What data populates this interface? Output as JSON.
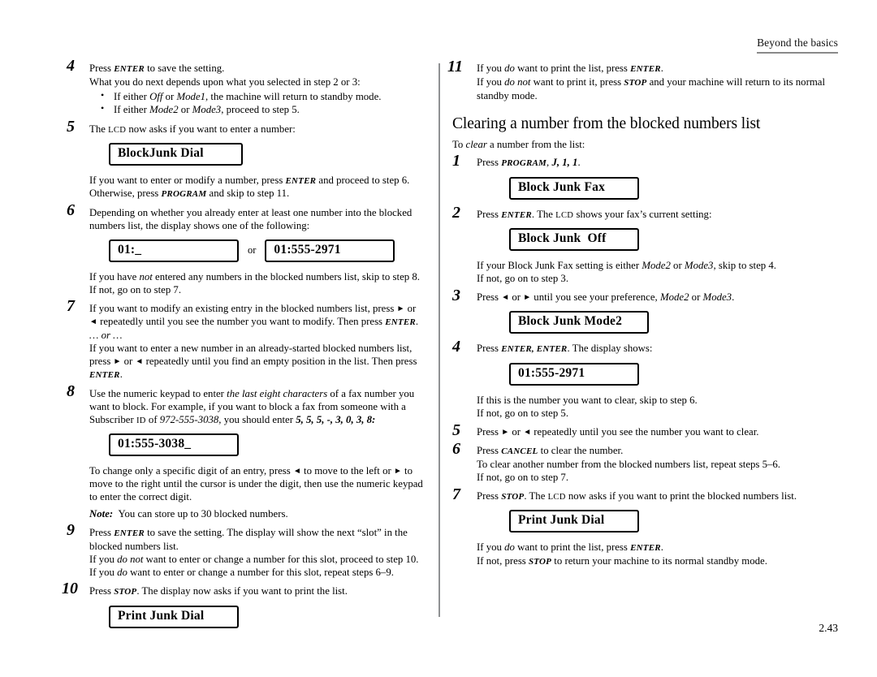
{
  "header": {
    "running_head": "Beyond the basics"
  },
  "footer": {
    "page_number": "2.43"
  },
  "left_column": {
    "step4": {
      "number": "4",
      "line1_a": "Press ",
      "line1_key": "ENTER",
      "line1_b": " to save the setting.",
      "line2": "What you do next depends upon what you selected in step 2 or 3:",
      "bullet1_a": "If either ",
      "bullet1_it1": "Off",
      "bullet1_b": " or ",
      "bullet1_it2": "Mode1",
      "bullet1_c": ", the machine will return to standby mode.",
      "bullet2_a": "If either ",
      "bullet2_it1": "Mode2",
      "bullet2_b": " or ",
      "bullet2_it2": "Mode3",
      "bullet2_c": ", proceed to step 5."
    },
    "step5": {
      "number": "5",
      "text_a": "The ",
      "text_sc": "LCD",
      "text_b": " now asks if you want to enter a number:",
      "lcd": "BlockJunk Dial",
      "after_a": "If you want to enter or modify a number, press ",
      "after_key1": "ENTER",
      "after_b": " and proceed to step 6.",
      "after_c": "Otherwise, press ",
      "after_key2": "PROGRAM",
      "after_d": " and skip to step 11."
    },
    "step6": {
      "number": "6",
      "text": "Depending on whether you already enter at least one number into the blocked numbers list, the display shows one of the following:",
      "lcd_left": "01:_",
      "or_label": "or",
      "lcd_right": "01:555-2971",
      "after_a": "If you have ",
      "after_it": "not",
      "after_b": " entered any numbers in the blocked numbers list, skip to step 8.",
      "after_c": "If not, go on to step 7."
    },
    "step7": {
      "number": "7",
      "line1_a": "If you want to modify an existing entry in the blocked numbers list, press ",
      "arrow_right": "►",
      "line1_b": " or ",
      "arrow_left": "◄",
      "line1_c": " repeatedly until you see the number you want to modify. Then press ",
      "line1_key": "ENTER",
      "line1_d": ".",
      "or_sep": "… or …",
      "line2_a": "If you want to enter a new number in an already-started blocked numbers list, press ",
      "line2_b": " or ",
      "line2_c": " repeatedly until you find an empty position in the list. Then press ",
      "line2_key": "ENTER",
      "line2_d": "."
    },
    "step8": {
      "number": "8",
      "text_a": "Use the numeric keypad to enter ",
      "text_it1": "the last eight characters",
      "text_b": " of a fax number you want to block. For example, if you want to block a fax from someone with a Subscriber ",
      "text_sc": "ID",
      "text_c": " of ",
      "text_it2": "972-555-3038",
      "text_d": ", you should enter ",
      "text_bi": "5, 5, 5, -, 3, 0, 3, 8:",
      "lcd": "01:555-3038_",
      "after_a": "To change only a specific digit of an entry, press ",
      "arrow_left": "◄",
      "after_b": " to move to the left or ",
      "arrow_right": "►",
      "after_c": " to move to the right until the cursor is under the digit, then use the numeric keypad to enter the correct digit.",
      "note_label": "Note:",
      "note_text": "You can store up to 30 blocked numbers."
    },
    "step9": {
      "number": "9",
      "line1_a": "Press ",
      "line1_key": "ENTER",
      "line1_b": " to save the setting. The display will show the next “slot” in the blocked numbers list.",
      "line2_a": "If you ",
      "line2_it": "do not",
      "line2_b": " want to enter or change a number for this slot, proceed to step 10.",
      "line3_a": "If you ",
      "line3_it": "do",
      "line3_b": " want to enter or change a number for this slot, repeat steps 6–9."
    },
    "step10": {
      "number": "10",
      "text_a": "Press ",
      "text_key": "STOP",
      "text_b": ". The display now asks if you want to print the list.",
      "lcd": "Print Junk Dial"
    }
  },
  "right_column": {
    "step11": {
      "number": "11",
      "line1_a": "If you ",
      "line1_it": "do",
      "line1_b": " want to print the list, press ",
      "line1_key": "ENTER",
      "line1_c": ".",
      "line2_a": "If you ",
      "line2_it": "do not",
      "line2_b": " want to print it, press ",
      "line2_key": "STOP",
      "line2_c": " and your machine will return to its normal standby mode."
    },
    "section": {
      "heading": "Clearing a number from the blocked numbers list",
      "intro_a": "To ",
      "intro_it": "clear",
      "intro_b": " a number from the list:"
    },
    "step1": {
      "number": "1",
      "text_a": "Press ",
      "text_key": "PROGRAM",
      "text_b": ", ",
      "text_bi": "J, 1, 1",
      "text_c": ".",
      "lcd": "Block Junk Fax"
    },
    "step2": {
      "number": "2",
      "text_a": "Press ",
      "text_key": "ENTER",
      "text_b": ". The ",
      "text_sc": "LCD",
      "text_c": " shows your fax’s current setting:",
      "lcd": "Block Junk  Off",
      "after_a": "If your Block Junk Fax setting is either ",
      "after_it1": "Mode2",
      "after_b": " or ",
      "after_it2": "Mode3,",
      "after_c": " skip to step 4.",
      "after_d": "If not, go on to step 3."
    },
    "step3": {
      "number": "3",
      "text_a": "Press ",
      "arrow_left": "◄",
      "text_b": " or ",
      "arrow_right": "►",
      "text_c": " until you see your preference, ",
      "text_it1": "Mode2",
      "text_d": " or ",
      "text_it2": "Mode3",
      "text_e": ".",
      "lcd": "Block Junk Mode2"
    },
    "step4": {
      "number": "4",
      "text_a": "Press ",
      "text_key": "ENTER, ENTER",
      "text_b": ". The display shows:",
      "lcd": "01:555-2971",
      "after_a": "If this is the number you want to clear, skip to step 6.",
      "after_b": "If not, go on to step 5."
    },
    "step5": {
      "number": "5",
      "text_a": "Press ",
      "arrow_right": "►",
      "text_b": " or ",
      "arrow_left": "◄",
      "text_c": " repeatedly until you see the number you want to clear."
    },
    "step6": {
      "number": "6",
      "line1_a": "Press ",
      "line1_key": "CANCEL",
      "line1_b": " to clear the number.",
      "line2": "To clear another number from the blocked numbers list, repeat steps 5–6.",
      "line3": "If not, go on to step 7."
    },
    "step7": {
      "number": "7",
      "text_a": "Press ",
      "text_key": "STOP",
      "text_b": ". The ",
      "text_sc": "LCD",
      "text_c": " now asks if you want to print the blocked numbers list.",
      "lcd": "Print Junk Dial",
      "after_a": "If you ",
      "after_it": "do",
      "after_b": " want to print the list, press ",
      "after_key": "ENTER",
      "after_c": ".",
      "after_d": "If not, press ",
      "after_key2": "STOP",
      "after_e": " to return your machine to its normal standby mode."
    }
  }
}
